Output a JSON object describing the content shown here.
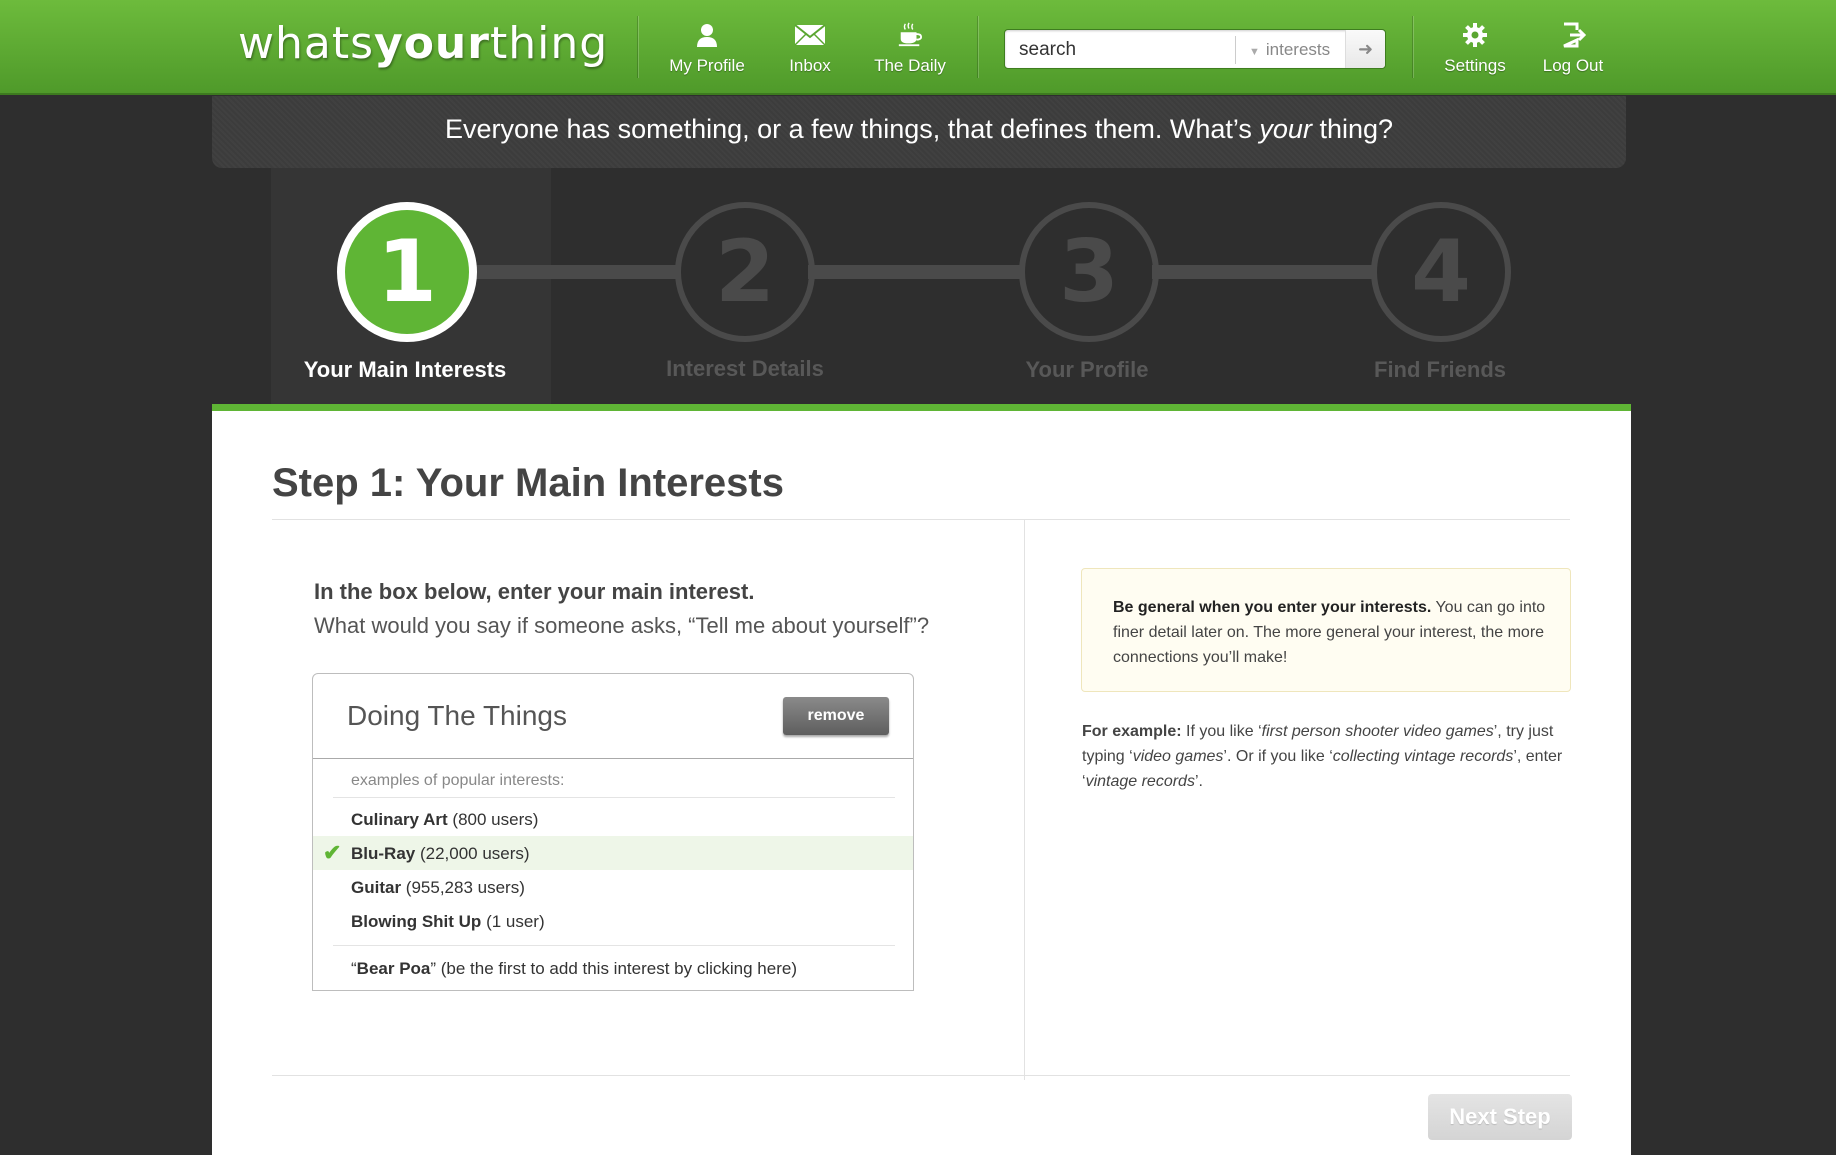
{
  "header": {
    "logo_part1": "whats",
    "logo_part2": "your",
    "logo_part3": "thing",
    "nav": [
      {
        "label": "My Profile",
        "icon": "person-icon"
      },
      {
        "label": "Inbox",
        "icon": "envelope-icon"
      },
      {
        "label": "The Daily",
        "icon": "coffee-cup-icon"
      }
    ],
    "search": {
      "value": "search",
      "category": "interests",
      "go_icon": "arrow-right-icon"
    },
    "right_nav": [
      {
        "label": "Settings",
        "icon": "gear-icon"
      },
      {
        "label": "Log Out",
        "icon": "logout-icon"
      }
    ]
  },
  "tagline": {
    "before": "Everyone has something, or a few things, that defines them. What’s ",
    "emphasis": "your",
    "after": " thing?"
  },
  "steps": [
    {
      "number": "1",
      "label": "Your Main Interests",
      "active": true
    },
    {
      "number": "2",
      "label": "Interest Details",
      "active": false
    },
    {
      "number": "3",
      "label": "Your Profile",
      "active": false
    },
    {
      "number": "4",
      "label": "Find Friends",
      "active": false
    }
  ],
  "main": {
    "title": "Step 1: Your Main Interests",
    "instruction_bold": "In the box below, enter your main interest.",
    "instruction_sub": "What would you say if someone asks, “Tell me about yourself”?",
    "interest_value": "Doing The Things",
    "remove_label": "remove",
    "examples_label": "examples of popular interests:",
    "suggestions": [
      {
        "name": "Culinary Art",
        "count": "(800 users)",
        "selected": false
      },
      {
        "name": "Blu-Ray",
        "count": "(22,000 users)",
        "selected": true
      },
      {
        "name": "Guitar",
        "count": "(955,283 users)",
        "selected": false
      },
      {
        "name": "Blowing Shit Up",
        "count": "(1 user)",
        "selected": false
      }
    ],
    "add_new": {
      "open_quote": "“",
      "term": "Bear Poa",
      "rest": "” (be the first to add this interest by clicking here)"
    },
    "tip": {
      "bold": "Be general when you enter your interests.",
      "rest": " You can go into finer detail later on. The more general your interest, the more connections you’ll make!"
    },
    "example": {
      "bold": "For example:",
      "t1": " If you like ‘",
      "i1": "first person shooter video games",
      "t2": "’, try just typing ‘",
      "i2": "video games",
      "t3": "’. Or if you like ‘",
      "i3": "collecting vintage records",
      "t4": "’, enter ‘",
      "i4": "vintage records",
      "t5": "’."
    },
    "next_label": "Next Step"
  },
  "colors": {
    "brand_green": "#5fb535",
    "background": "#2e2e2e"
  }
}
